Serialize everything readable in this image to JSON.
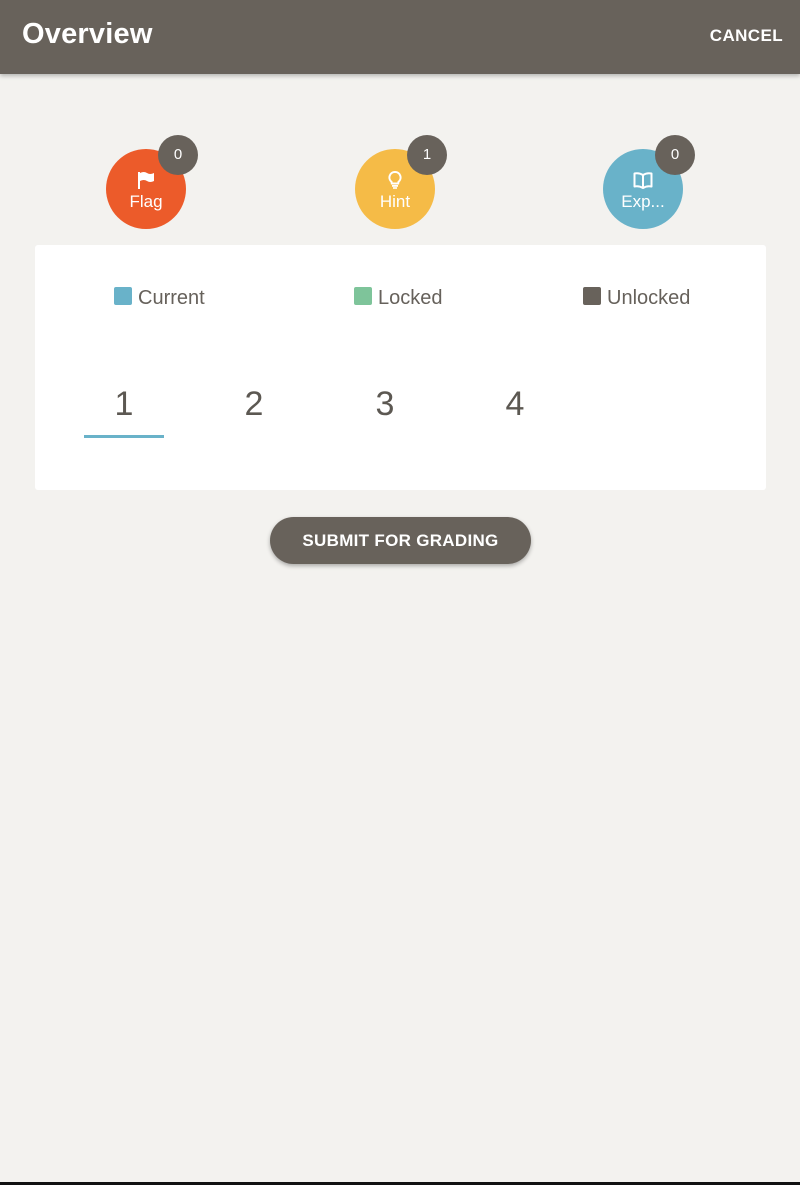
{
  "header": {
    "title": "Overview",
    "cancel_label": "CANCEL"
  },
  "stats": [
    {
      "label": "Flag",
      "count": "0",
      "icon": "flag-icon",
      "color": "#ec5b2a"
    },
    {
      "label": "Hint",
      "count": "1",
      "icon": "lightbulb-icon",
      "color": "#f5bb47"
    },
    {
      "label": "Exp...",
      "count": "0",
      "icon": "book-icon",
      "color": "#69b2c9"
    }
  ],
  "legend": [
    {
      "label": "Current",
      "color": "#69b2c9"
    },
    {
      "label": "Locked",
      "color": "#7ec49a"
    },
    {
      "label": "Unlocked",
      "color": "#68625b"
    }
  ],
  "pages": [
    "1",
    "2",
    "3",
    "4"
  ],
  "current_page": "1",
  "submit_label": "SUBMIT FOR GRADING"
}
